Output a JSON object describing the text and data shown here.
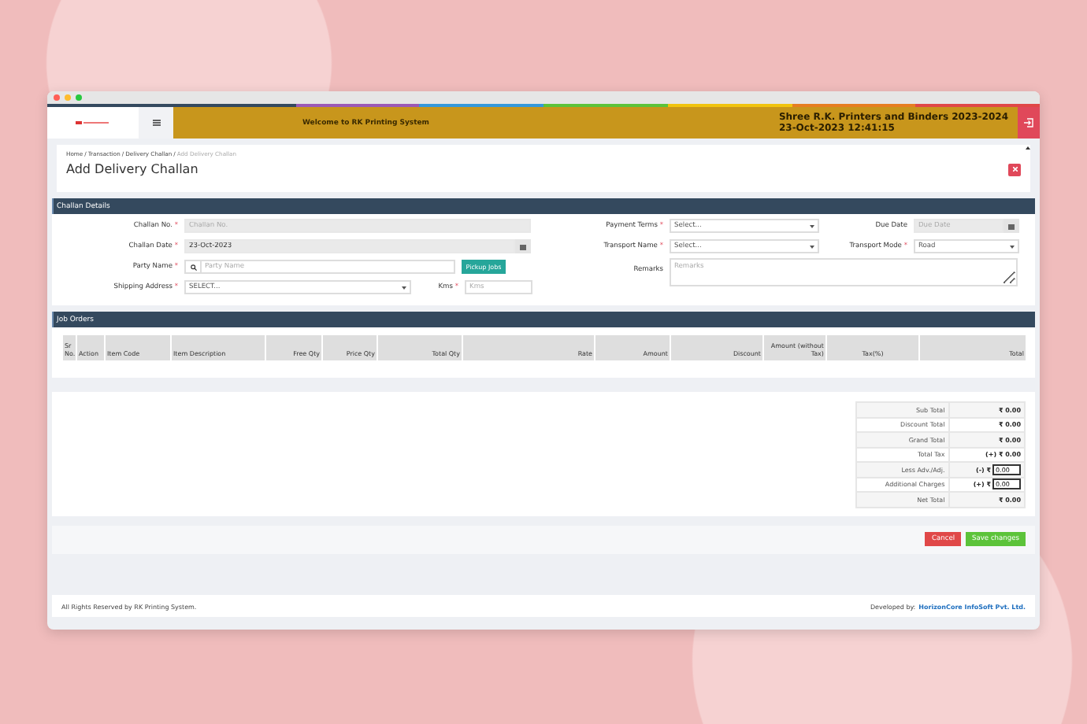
{
  "header": {
    "welcome": "Welcome to RK Printing System",
    "company": "Shree R.K. Printers and Binders 2023-2024",
    "datetime": "23-Oct-2023 12:41:15"
  },
  "breadcrumb": {
    "separator": "/",
    "items": [
      "Home",
      "Transaction",
      "Delivery Challan",
      "Add Delivery Challan"
    ]
  },
  "page_title": "Add Delivery Challan",
  "challan_details": {
    "title": "Challan Details",
    "required_mark": "*",
    "challan_no": {
      "label": "Challan No.",
      "required": true,
      "placeholder": "Challan No.",
      "disabled": true
    },
    "challan_date": {
      "label": "Challan Date",
      "required": true,
      "value": "23-Oct-2023",
      "disabled": true
    },
    "party_name": {
      "label": "Party Name",
      "required": true,
      "placeholder": "Party Name",
      "disabled": false
    },
    "pickup_button": "Pickup Jobs",
    "shipping_address": {
      "label": "Shipping Address",
      "required": true,
      "value": "SELECT..."
    },
    "kms": {
      "label": "Kms",
      "required": true,
      "placeholder": "Kms",
      "disabled": false
    },
    "payment_terms": {
      "label": "Payment Terms",
      "required": true,
      "value": "Select..."
    },
    "due_date": {
      "label": "Due Date",
      "required": false,
      "placeholder": "Due Date",
      "disabled": true
    },
    "transport_name": {
      "label": "Transport Name",
      "required": true,
      "value": "Select..."
    },
    "transport_mode": {
      "label": "Transport Mode",
      "required": true,
      "value": "Road"
    },
    "remarks": {
      "label": "Remarks",
      "required": false,
      "placeholder": "Remarks"
    }
  },
  "job_orders": {
    "title": "Job Orders",
    "columns": [
      "Sr No.",
      "Action",
      "Item Code",
      "Item Description",
      "Free Qty",
      "Price Qty",
      "Total Qty",
      "Rate",
      "Amount",
      "Discount",
      "Amount (without Tax)",
      "Tax(%)",
      "Total"
    ]
  },
  "totals": [
    {
      "kind": "text",
      "label": "Sub Total",
      "value": "₹ 0.00"
    },
    {
      "kind": "text",
      "label": "Discount Total",
      "value": "₹ 0.00"
    },
    {
      "kind": "text",
      "label": "Grand Total",
      "value": "₹ 0.00"
    },
    {
      "kind": "text",
      "label": "Total Tax",
      "value": "(+) ₹ 0.00"
    },
    {
      "kind": "input",
      "label": "Less Adv./Adj.",
      "prefix": "(-) ₹",
      "value": "0.00"
    },
    {
      "kind": "input",
      "label": "Additional Charges",
      "prefix": "(+) ₹",
      "value": "0.00"
    },
    {
      "kind": "text",
      "label": "Net Total",
      "value": "₹ 0.00"
    }
  ],
  "actions": [
    {
      "label": "Cancel",
      "kind": "danger"
    },
    {
      "label": "Save changes",
      "kind": "success"
    }
  ],
  "footer": {
    "copyright": "All Rights Reserved by RK Printing System.",
    "developed_label": "Developed by:",
    "developer_link": "HorizonCore InfoSoft Pvt. Ltd."
  }
}
